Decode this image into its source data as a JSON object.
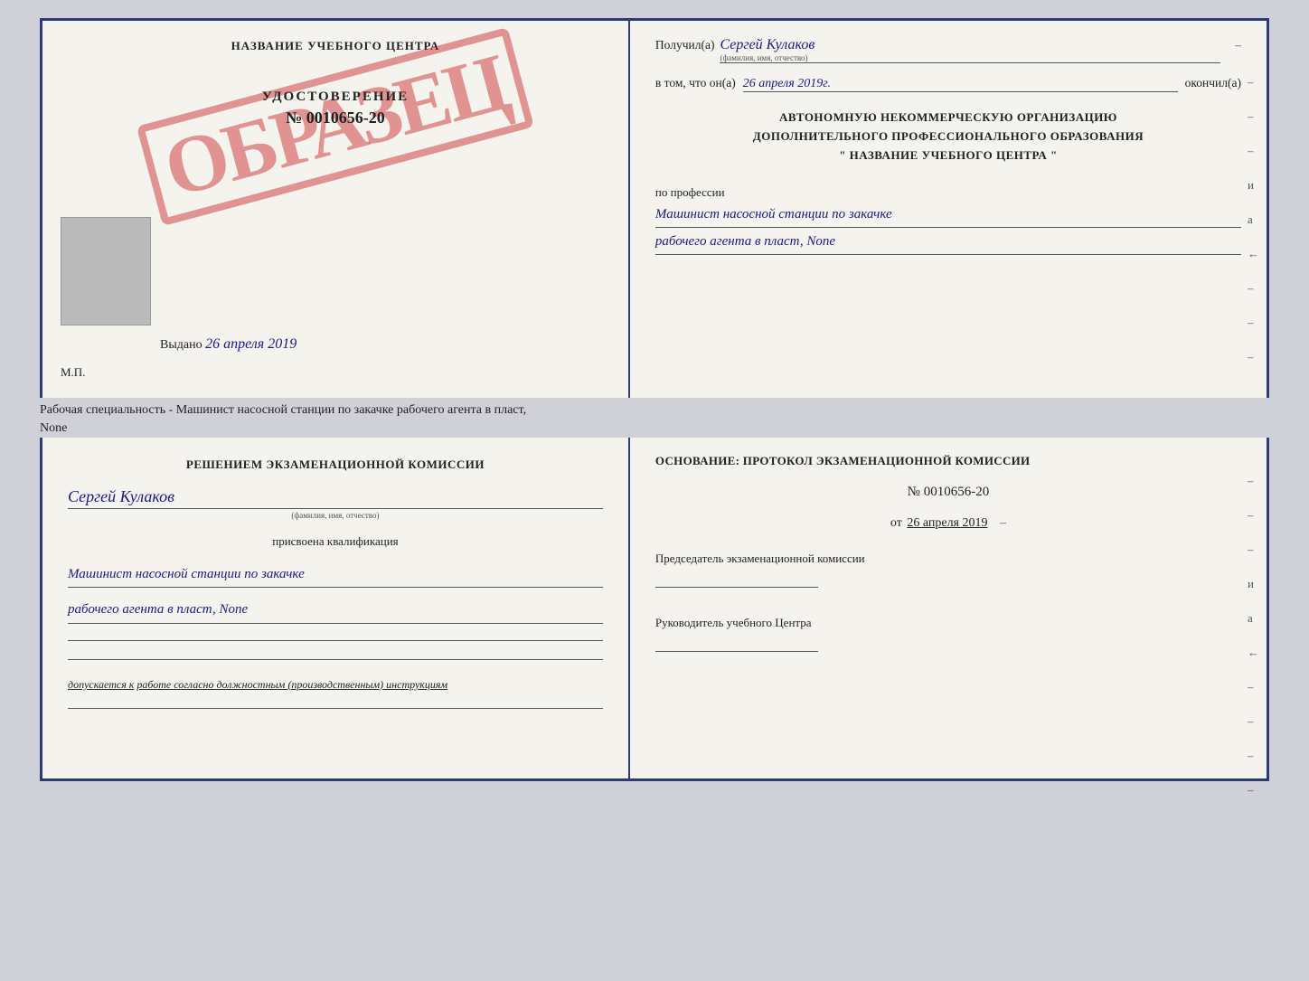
{
  "top_cert": {
    "left": {
      "center_title": "НАЗВАНИЕ УЧЕБНОГО ЦЕНТРА",
      "stamp_text": "ОБРАЗЕЦ",
      "udostoverenie_label": "УДОСТОВЕРЕНИЕ",
      "number": "№ 0010656-20",
      "vydano_prefix": "Выдано",
      "vydano_date": "26 апреля 2019",
      "mp_label": "М.П."
    },
    "right": {
      "poluchil_label": "Получил(a)",
      "poluchil_value": "Сергей Кулаков",
      "familiya_hint": "(фамилия, имя, отчество)",
      "v_tom_label": "в том, что он(а)",
      "v_tom_date": "26 апреля 2019г.",
      "okonchil_label": "окончил(а)",
      "center_line1": "АВТОНОМНУЮ НЕКОММЕРЧЕСКУЮ ОРГАНИЗАЦИЮ",
      "center_line2": "ДОПОЛНИТЕЛЬНОГО ПРОФЕССИОНАЛЬНОГО ОБРАЗОВАНИЯ",
      "center_line3": "\"  НАЗВАНИЕ УЧЕБНОГО ЦЕНТРА  \"",
      "po_professii": "по профессии",
      "profession_line1": "Машинист насосной станции по закачке",
      "profession_line2": "рабочего агента в пласт, None",
      "dashes": [
        "-",
        "-",
        "-",
        "и",
        "а",
        "←",
        "-",
        "-",
        "-"
      ]
    }
  },
  "separator": {
    "text": "Рабочая специальность - Машинист насосной станции по закачке рабочего агента в пласт,",
    "text2": "None"
  },
  "bottom_cert": {
    "left": {
      "komissia_text": "Решением экзаменационной комиссии",
      "name_value": "Сергей Кулаков",
      "familiya_hint": "(фамилия, имя, отчество)",
      "prisvoena": "присвоена квалификация",
      "qual_line1": "Машинист насосной станции по закачке",
      "qual_line2": "рабочего агента в пласт, None",
      "dopuskaetsya_label": "допускается к",
      "dopuskaetsya_value": "работе согласно должностным (производственным) инструкциям"
    },
    "right": {
      "osnovanie_text": "Основание: протокол экзаменационной комиссии",
      "protocol_number": "№ 0010656-20",
      "protocol_date_prefix": "от",
      "protocol_date": "26 апреля 2019",
      "predsedatel_label": "Председатель экзаменационной комиссии",
      "rukovoditel_label": "Руководитель учебного Центра",
      "dashes": [
        "-",
        "-",
        "-",
        "и",
        "а",
        "←",
        "-",
        "-",
        "-",
        "-"
      ]
    }
  }
}
